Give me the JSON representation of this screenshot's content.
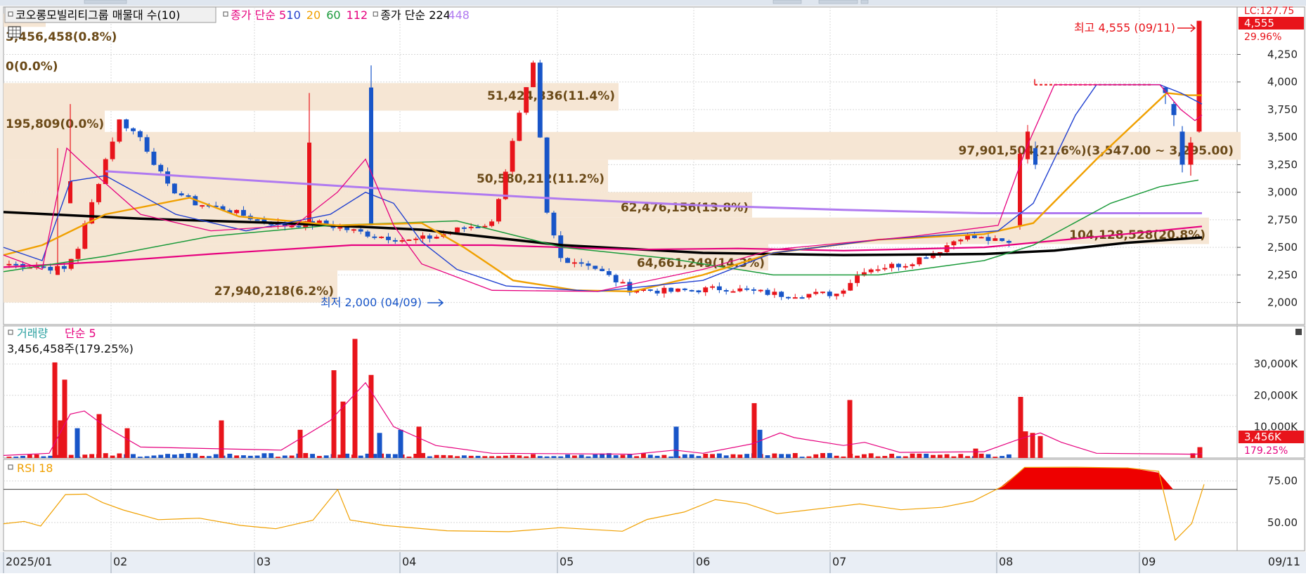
{
  "legend": {
    "main": [
      {
        "text": "코오롱모빌리티그룹 매물대 수(10)",
        "color": "#000000"
      },
      {
        "text": "종가 단순 5",
        "color": "#e6007e"
      },
      {
        "text": "10",
        "color": "#1f3fd0"
      },
      {
        "text": "20",
        "color": "#f0a000"
      },
      {
        "text": "60",
        "color": "#1a9a3a"
      },
      {
        "text": "112",
        "color": "#e6007e"
      },
      {
        "text": "종가 단순 224",
        "color": "#000000"
      },
      {
        "text": "448",
        "color": "#b07af0"
      }
    ],
    "volume": [
      {
        "text": "거래량",
        "color": "#2aa0a0"
      },
      {
        "text": "단순 5",
        "color": "#e6007e"
      }
    ],
    "volume_value": "3,456,458주(179.25%)",
    "rsi": "RSI 18"
  },
  "colors": {
    "up": "#e8141b",
    "down": "#1855c8",
    "volume_profile": "#f6e6d4",
    "profile_text": "#6b4a18",
    "ma5": "#e6007e",
    "ma10": "#1f3fd0",
    "ma20": "#f0a000",
    "ma60": "#1a9a3a",
    "ma112": "#e6007e",
    "ma224": "#000000",
    "ma448": "#b07af0",
    "rsi": "#f0a000",
    "grid": "#d8d8d8",
    "axis_bg": "#ffffff"
  },
  "price_panel": {
    "current_price": "4,555",
    "change_pct": "29.96%",
    "lc_label": "LC:127.75",
    "high_annotation": "최고 4,555 (09/11)",
    "low_annotation": "최저 2,000 (04/09)",
    "volume_profile_labels": [
      "3,456,458(0.8%)",
      "0(0.0%)",
      "51,424,336(11.4%)",
      "195,809(0.0%)",
      "97,901,504(21.6%)(3,547.00 ~ 3,295.00)",
      "50,580,212(11.2%)",
      "62,476,156(13.8%)",
      "104,128,528(20.8%)",
      "64,661,249(14.3%)",
      "27,940,218(6.2%)"
    ]
  },
  "volume_panel": {
    "current_value": "3,456K",
    "current_pct": "179.25%"
  },
  "x_axis": {
    "tick_labels": [
      "2025/01",
      "02",
      "03",
      "04",
      "05",
      "06",
      "07",
      "08",
      "09"
    ],
    "current_date": "09/11"
  },
  "chart_data": [
    {
      "type": "candlestick",
      "title": "코오롱모빌리티그룹",
      "ylim": [
        1800,
        4680
      ],
      "y_ticks": [
        2000,
        2250,
        2500,
        2750,
        3000,
        3250,
        3500,
        3750,
        4000,
        4250
      ],
      "x": [
        "2025/01",
        "02",
        "03",
        "04",
        "05",
        "06",
        "07",
        "08",
        "09"
      ],
      "close_by_month_start": [
        2350,
        2850,
        2600,
        3000,
        2150,
        2200,
        2450,
        2650,
        3950
      ],
      "high": 4555,
      "high_date": "09/11",
      "low": 2000,
      "low_date": "04/09",
      "volume_profile": [
        {
          "range": [
            4500,
            4620
          ],
          "volume": 3456458,
          "pct": 0.8
        },
        {
          "range": [
            4380,
            4500
          ],
          "volume": 0,
          "pct": 0.0
        },
        {
          "range": [
            3740,
            3990
          ],
          "volume": 51424336,
          "pct": 11.4
        },
        {
          "range": [
            3490,
            3740
          ],
          "volume": 195809,
          "pct": 0.0
        },
        {
          "range": [
            3295,
            3547
          ],
          "volume": 97901504,
          "pct": 21.6
        },
        {
          "range": [
            3000,
            3295
          ],
          "volume": 50580212,
          "pct": 11.2
        },
        {
          "range": [
            2770,
            3000
          ],
          "volume": 62476156,
          "pct": 13.8
        },
        {
          "range": [
            2530,
            2770
          ],
          "volume": 104128528,
          "pct": 20.8
        },
        {
          "range": [
            2290,
            2530
          ],
          "volume": 64661249,
          "pct": 14.3
        },
        {
          "range": [
            2000,
            2290
          ],
          "volume": 27940218,
          "pct": 6.2
        }
      ],
      "series": [
        {
          "name": "종가 단순 224",
          "start": 2820,
          "end": 2590
        },
        {
          "name": "448",
          "start": 3190,
          "end": 2810
        },
        {
          "name": "112",
          "start": 2320,
          "end": 2690
        }
      ]
    },
    {
      "type": "bar",
      "title": "거래량",
      "y_ticks": [
        10000,
        20000,
        30000
      ],
      "y_tick_labels": [
        "10,000K",
        "20,000K",
        "30,000K"
      ],
      "ylim": [
        0,
        39000
      ],
      "unit": "K",
      "spikes": [
        {
          "month": "01",
          "values": [
            30500,
            25000,
            14000
          ]
        },
        {
          "month": "03",
          "values": [
            38000,
            27000,
            22000,
            17000
          ]
        },
        {
          "month": "06",
          "values": [
            10000,
            17500
          ]
        },
        {
          "month": "07",
          "values": [
            18500
          ]
        },
        {
          "month": "08",
          "values": [
            19500,
            8500
          ]
        },
        {
          "month": "09",
          "values": [
            3456
          ]
        }
      ]
    },
    {
      "type": "line",
      "title": "RSI 18",
      "ylim": [
        33,
        88
      ],
      "y_ticks": [
        50,
        75
      ],
      "y_tick_labels": [
        "50.00",
        "75.00"
      ],
      "reference_line": 70,
      "points": [
        [
          0,
          50
        ],
        [
          10,
          51
        ],
        [
          18,
          48
        ],
        [
          30,
          66
        ],
        [
          40,
          67
        ],
        [
          48,
          62
        ],
        [
          58,
          57
        ],
        [
          75,
          52
        ],
        [
          95,
          53
        ],
        [
          115,
          49
        ],
        [
          132,
          47
        ],
        [
          150,
          52
        ],
        [
          162,
          70
        ],
        [
          168,
          52
        ],
        [
          185,
          48
        ],
        [
          215,
          46
        ],
        [
          245,
          45
        ],
        [
          270,
          46
        ],
        [
          300,
          45
        ],
        [
          312,
          52
        ],
        [
          330,
          56
        ],
        [
          345,
          63
        ],
        [
          360,
          62
        ],
        [
          375,
          56
        ],
        [
          400,
          58
        ],
        [
          415,
          62
        ],
        [
          435,
          57
        ],
        [
          455,
          60
        ],
        [
          470,
          63
        ],
        [
          485,
          73
        ],
        [
          495,
          83
        ],
        [
          520,
          83
        ],
        [
          545,
          83
        ],
        [
          560,
          80
        ],
        [
          568,
          40
        ],
        [
          576,
          50
        ],
        [
          582,
          73
        ]
      ]
    }
  ]
}
